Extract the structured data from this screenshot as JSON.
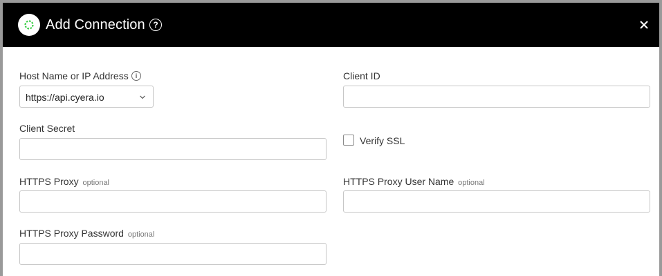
{
  "dialog": {
    "title": "Add Connection",
    "help_glyph": "?",
    "close_glyph": "close-icon"
  },
  "colors": {
    "header_bg": "#000000",
    "logo_accent": "#3ecf4a",
    "border": "#c6c6c6"
  },
  "form": {
    "host": {
      "label": "Host Name or IP Address",
      "info_glyph": "i",
      "selected": "https://api.cyera.io"
    },
    "client_id": {
      "label": "Client ID",
      "value": ""
    },
    "client_secret": {
      "label": "Client Secret",
      "value": ""
    },
    "verify_ssl": {
      "label": "Verify SSL",
      "checked": false
    },
    "https_proxy": {
      "label": "HTTPS Proxy",
      "optional": "optional",
      "value": ""
    },
    "https_proxy_user": {
      "label": "HTTPS Proxy User Name",
      "optional": "optional",
      "value": ""
    },
    "https_proxy_password": {
      "label": "HTTPS Proxy Password",
      "optional": "optional",
      "value": ""
    }
  }
}
